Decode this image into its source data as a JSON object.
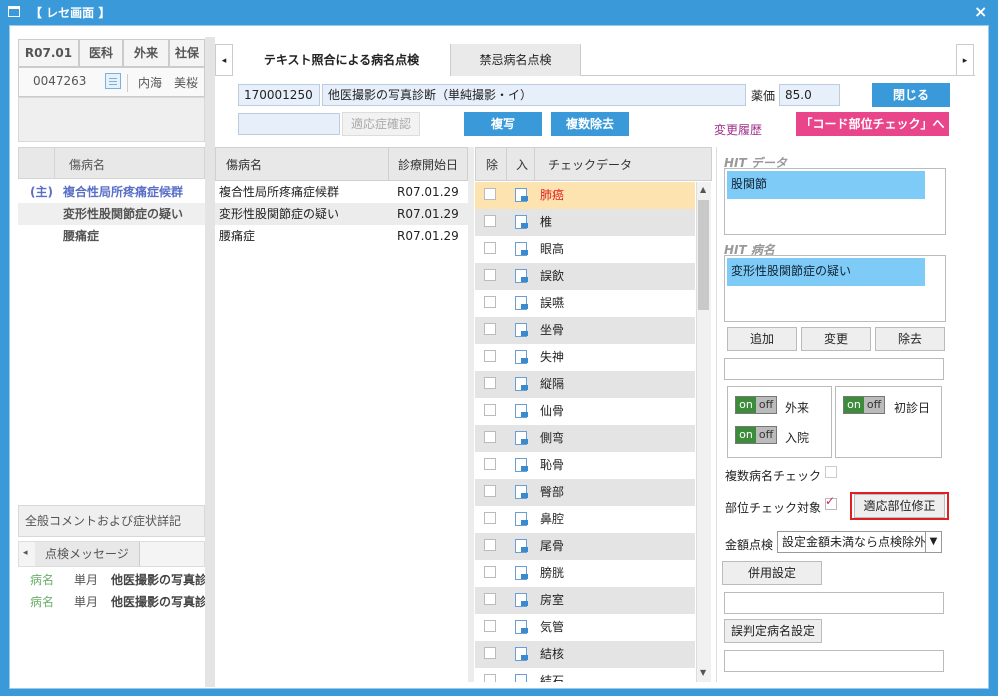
{
  "window": {
    "title": "【 レセ画面 】",
    "close_icon": "×"
  },
  "patient": {
    "date": "R07.01",
    "kind": "医科",
    "outpatient": "外来",
    "insurance": "社保",
    "id": "0047263",
    "name": "内海　美桜"
  },
  "left": {
    "disease_header": "傷病名",
    "diseases": [
      {
        "marker": "(主)",
        "name": "複合性局所疼痛症候群"
      },
      {
        "marker": "",
        "name": "変形性股関節症の疑い"
      },
      {
        "marker": "",
        "name": "腰痛症"
      }
    ],
    "comment_header": "全般コメントおよび症状詳記",
    "message_tab": "点検メッセージ",
    "messages": [
      {
        "kind": "病名",
        "freq": "単月",
        "text": "他医撮影の写真診"
      },
      {
        "kind": "病名",
        "freq": "単月",
        "text": "他医撮影の写真診"
      }
    ]
  },
  "tabs": [
    "テキスト照合による病名点検",
    "禁忌病名点検"
  ],
  "toolbar": {
    "code": "170001250",
    "item": "他医撮影の写真診断（単純撮影・イ）",
    "price_label": "薬価",
    "price": "85.0",
    "close_btn": "閉じる",
    "indication_placeholder": "",
    "indication_btn": "適応症確認",
    "copy_btn": "複写",
    "multi_remove_btn": "複数除去",
    "history_link": "変更履歴",
    "code_check_btn": "「コード部位チェック」へ"
  },
  "disease_table": {
    "headers": [
      "傷病名",
      "診療開始日"
    ],
    "rows": [
      {
        "name": "複合性局所疼痛症候群",
        "date": "R07.01.29"
      },
      {
        "name": "変形性股関節症の疑い",
        "date": "R07.01.29"
      },
      {
        "name": "腰痛症",
        "date": "R07.01.29"
      }
    ]
  },
  "check_table": {
    "headers": [
      "除",
      "入",
      "チェックデータ"
    ],
    "rows": [
      "肺癌",
      "椎",
      "眼高",
      "誤飲",
      "誤嚥",
      "坐骨",
      "失神",
      "縦隔",
      "仙骨",
      "側弯",
      "恥骨",
      "臀部",
      "鼻腔",
      "尾骨",
      "膀胱",
      "房室",
      "気管",
      "結核",
      "結石"
    ]
  },
  "right": {
    "hit_data_label": "HIT データ",
    "hit_data_value": "股関節",
    "hit_disease_label": "HIT 病名",
    "hit_disease_value": "変形性股関節症の疑い",
    "add_btn": "追加",
    "change_btn": "変更",
    "remove_btn": "除去",
    "toggle_on": "on",
    "toggle_off": "off",
    "outpatient_label": "外来",
    "inpatient_label": "入院",
    "first_visit_label": "初診日",
    "multi_disease_check": "複数病名チェック",
    "site_check_target": "部位チェック対象",
    "site_fix_btn": "適応部位修正",
    "amount_check_label": "金額点検",
    "amount_check_value": "設定金額未満なら点検除外",
    "combined_btn": "併用設定",
    "misjudge_btn": "誤判定病名設定"
  },
  "colors": {
    "accent": "#3a9ad9",
    "highlight_row": "#fde3b0",
    "red_text": "#e02020",
    "pink": "#e8458b"
  }
}
